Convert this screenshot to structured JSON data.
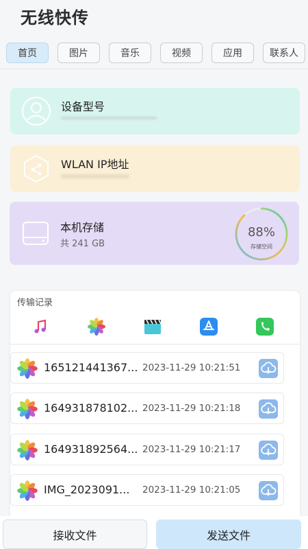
{
  "app": {
    "title": "无线快传"
  },
  "tabs": [
    {
      "label": "首页",
      "active": true
    },
    {
      "label": "图片"
    },
    {
      "label": "音乐"
    },
    {
      "label": "视频"
    },
    {
      "label": "应用"
    },
    {
      "label": "联系人"
    }
  ],
  "device": {
    "label": "设备型号",
    "value_icon": "person-circle-icon"
  },
  "wlan": {
    "label": "WLAN IP地址",
    "value_icon": "network-hexagon-icon"
  },
  "storage": {
    "label": "本机存储",
    "total": "共 241 GB",
    "percent_text": "88%",
    "percent": 88,
    "ring_label": "存储空间",
    "icon": "drive-icon"
  },
  "records": {
    "title": "传输记录",
    "filters": [
      "music-icon",
      "photos-icon",
      "video-clapper-icon",
      "app-store-icon",
      "phone-icon"
    ],
    "items": [
      {
        "name": "165121441367...",
        "time": "2023-11-29 10:21:51",
        "icon": "photos-icon"
      },
      {
        "name": "164931878102...",
        "time": "2023-11-29 10:21:18",
        "icon": "photos-icon"
      },
      {
        "name": "164931892564...",
        "time": "2023-11-29 10:21:17",
        "icon": "photos-icon"
      },
      {
        "name": "IMG_2023091...",
        "time": "2023-11-29 10:21:05",
        "icon": "photos-icon"
      }
    ]
  },
  "bottom": {
    "receive_label": "接收文件",
    "send_label": "发送文件"
  },
  "colors": {
    "device_card": "#d7f5ee",
    "wlan_card": "#fbefd6",
    "storage_card": "#e4dcf7",
    "accent": "#8cb8ea",
    "send_button": "#cfe7fb"
  }
}
